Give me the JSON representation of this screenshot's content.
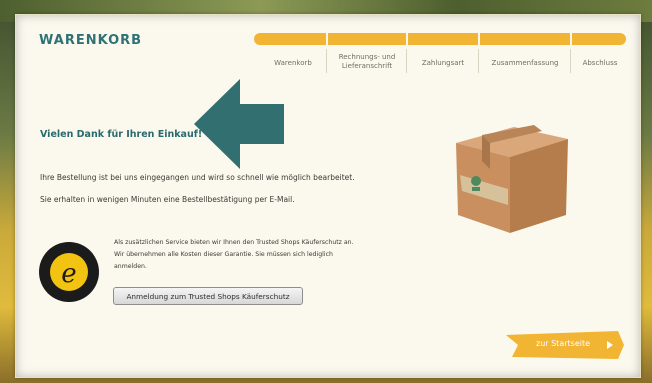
{
  "cart": {
    "title": "WARENKORB",
    "steps": [
      {
        "label": "Warenkorb"
      },
      {
        "label": "Rechnungs- und\nLieferanschrift"
      },
      {
        "label": "Zahlungsart"
      },
      {
        "label": "Zusammenfassung"
      },
      {
        "label": "Abschluss"
      }
    ]
  },
  "confirmation": {
    "heading": "Vielen Dank für Ihren Einkauf!",
    "line1": "Ihre Bestellung ist bei uns eingegangen und wird so schnell wie möglich bearbeitet.",
    "line2": "Sie erhalten in wenigen Minuten eine Bestellbestätigung per E-Mail."
  },
  "trusted_shops": {
    "text": "Als zusätzlichen Service bieten wir Ihnen den Trusted Shops Käuferschutz an. Wir übernehmen alle Kosten dieser Garantie. Sie müssen sich lediglich anmelden.",
    "button_label": "Anmeldung zum Trusted Shops Käuferschutz"
  },
  "footer": {
    "start_label": "zur Startseite"
  },
  "colors": {
    "accent": "#f2b433",
    "title": "#2f7276",
    "arrow": "#2a6a6e"
  }
}
